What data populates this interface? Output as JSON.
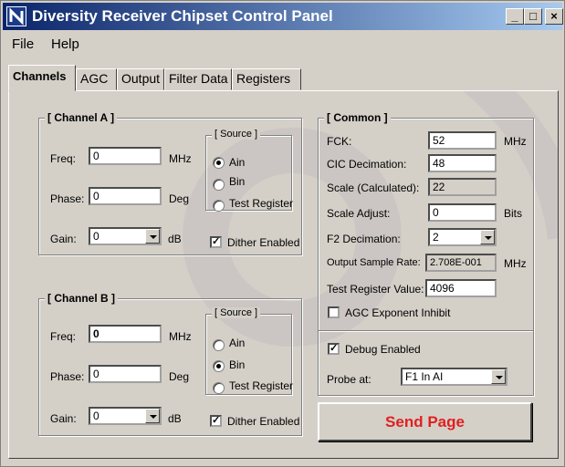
{
  "window": {
    "title": "Diversity Receiver Chipset Control Panel"
  },
  "menu": {
    "file": "File",
    "help": "Help"
  },
  "tabs": [
    "Channels",
    "AGC",
    "Output",
    "Filter Data",
    "Registers"
  ],
  "channel_a": {
    "title": "[ Channel A ]",
    "freq_label": "Freq:",
    "freq_value": "0",
    "freq_unit": "MHz",
    "phase_label": "Phase:",
    "phase_value": "0",
    "phase_unit": "Deg",
    "gain_label": "Gain:",
    "gain_value": "0",
    "gain_unit": "dB",
    "source_title": "[ Source ]",
    "source_options": [
      "Ain",
      "Bin",
      "Test Register"
    ],
    "source_selected": "Ain",
    "dither_label": "Dither Enabled",
    "dither_checked": true
  },
  "channel_b": {
    "title": "[ Channel B ]",
    "freq_label": "Freq:",
    "freq_value": "0",
    "freq_unit": "MHz",
    "phase_label": "Phase:",
    "phase_value": "0",
    "phase_unit": "Deg",
    "gain_label": "Gain:",
    "gain_value": "0",
    "gain_unit": "dB",
    "source_title": "[ Source ]",
    "source_options": [
      "Ain",
      "Bin",
      "Test Register"
    ],
    "source_selected": "Bin",
    "dither_label": "Dither Enabled",
    "dither_checked": true
  },
  "common": {
    "title": "[ Common ]",
    "fck_label": "FCK:",
    "fck_value": "52",
    "fck_unit": "MHz",
    "cic_label": "CIC Decimation:",
    "cic_value": "48",
    "scale_label": "Scale (Calculated):",
    "scale_value": "22",
    "scale_adjust_label": "Scale Adjust:",
    "scale_adjust_value": "0",
    "scale_adjust_unit": "Bits",
    "f2_label": "F2 Decimation:",
    "f2_value": "2",
    "osr_label": "Output Sample Rate:",
    "osr_value": "2.708E-001",
    "osr_unit": "MHz",
    "test_reg_label": "Test Register Value:",
    "test_reg_value": "4096",
    "agc_inhibit_label": "AGC Exponent Inhibit",
    "agc_inhibit_checked": false
  },
  "debug": {
    "enabled_label": "Debug Enabled",
    "enabled_checked": true,
    "probe_label": "Probe at:",
    "probe_value": "F1 In AI"
  },
  "send_button": "Send Page",
  "colors": {
    "title_start": "#0a246a",
    "title_end": "#a6caf0",
    "face": "#d4d0c8",
    "send_text": "#e02020"
  },
  "icons": {
    "app": "app-logo-icon",
    "minimize": "minimize-icon",
    "maximize": "maximize-icon",
    "close": "close-icon"
  }
}
